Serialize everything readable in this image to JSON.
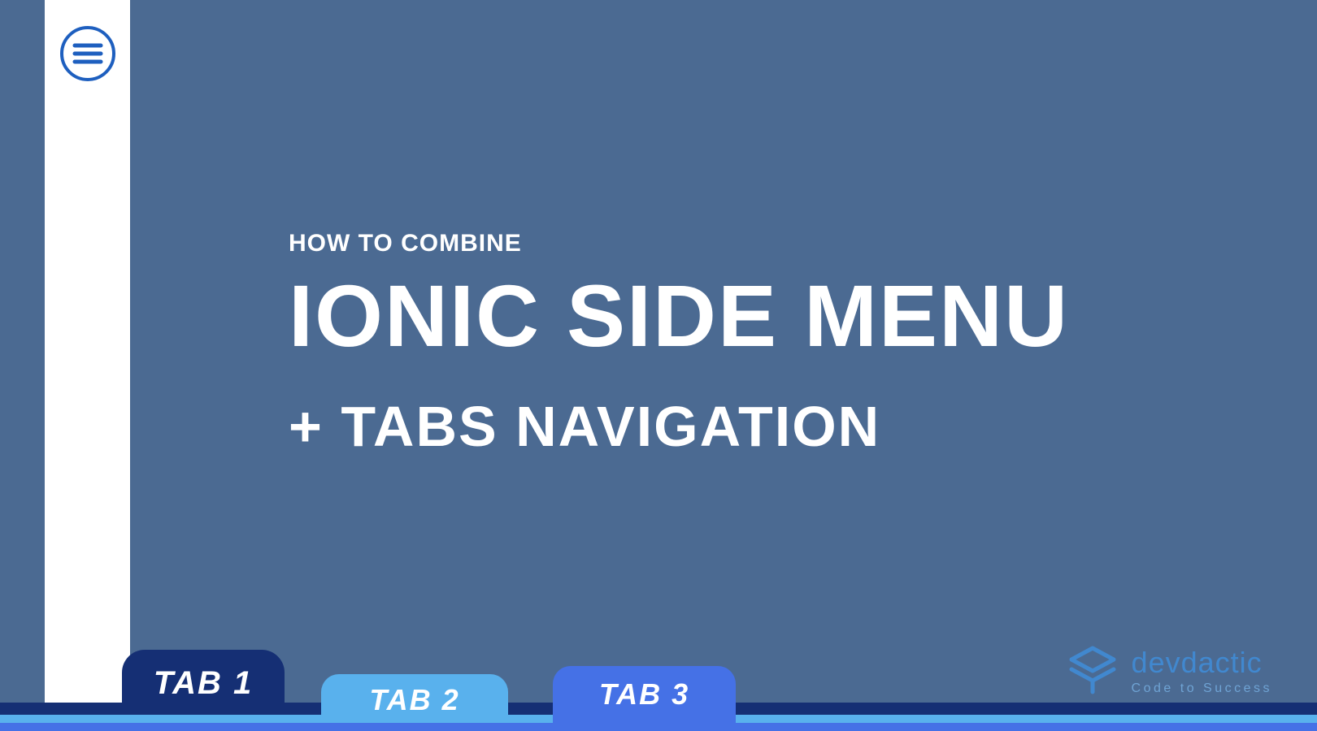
{
  "headline": {
    "eyebrow": "HOW TO COMBINE",
    "title": "IONIC SIDE MENU",
    "subtitle": "+ TABS NAVIGATION"
  },
  "tabs": {
    "tab1": "TAB 1",
    "tab2": "TAB 2",
    "tab3": "TAB 3"
  },
  "logo": {
    "name": "devdactic",
    "tagline": "Code to Success"
  },
  "colors": {
    "bg": "#4b6a92",
    "navy": "#152f74",
    "light": "#59b1ed",
    "mid": "#4571e6",
    "brand": "#4188cf"
  }
}
